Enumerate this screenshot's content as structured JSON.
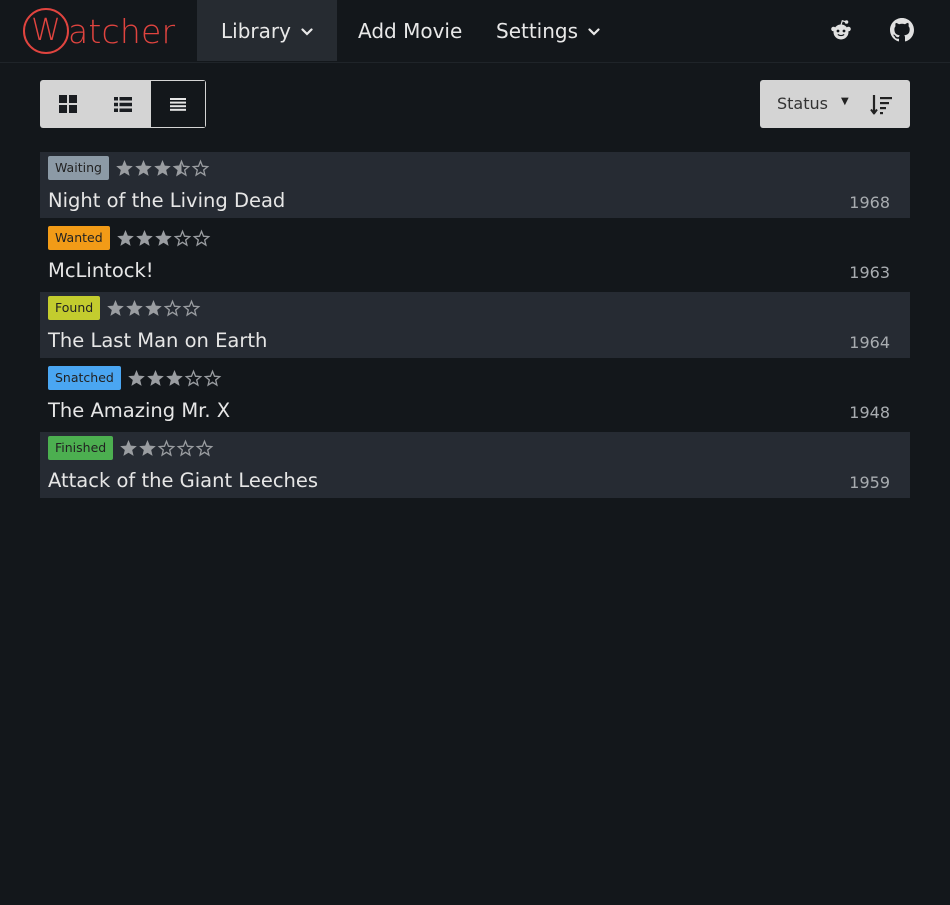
{
  "nav": {
    "brand_initial": "W",
    "brand_rest": "atcher",
    "library_label": "Library",
    "add_movie_label": "Add Movie",
    "settings_label": "Settings"
  },
  "toolbar": {
    "views": [
      "grid-view",
      "list-view",
      "compact-view"
    ],
    "active_view": "compact-view",
    "sort_label": "Status"
  },
  "colors": {
    "brand": "#e0443f",
    "waiting": "#8c9aa6",
    "wanted": "#f29b17",
    "found": "#c3cc2e",
    "snatched": "#4aa6f2",
    "finished": "#4caf50"
  },
  "movies": [
    {
      "status": "Waiting",
      "status_color": "#8c9aa6",
      "rating": 3.5,
      "title": "Night of the Living Dead",
      "year": "1968"
    },
    {
      "status": "Wanted",
      "status_color": "#f29b17",
      "rating": 3,
      "title": "McLintock!",
      "year": "1963"
    },
    {
      "status": "Found",
      "status_color": "#c3cc2e",
      "rating": 3,
      "title": "The Last Man on Earth",
      "year": "1964"
    },
    {
      "status": "Snatched",
      "status_color": "#4aa6f2",
      "rating": 3,
      "title": "The Amazing Mr. X",
      "year": "1948"
    },
    {
      "status": "Finished",
      "status_color": "#4caf50",
      "rating": 2,
      "title": "Attack of the Giant Leeches",
      "year": "1959"
    }
  ]
}
